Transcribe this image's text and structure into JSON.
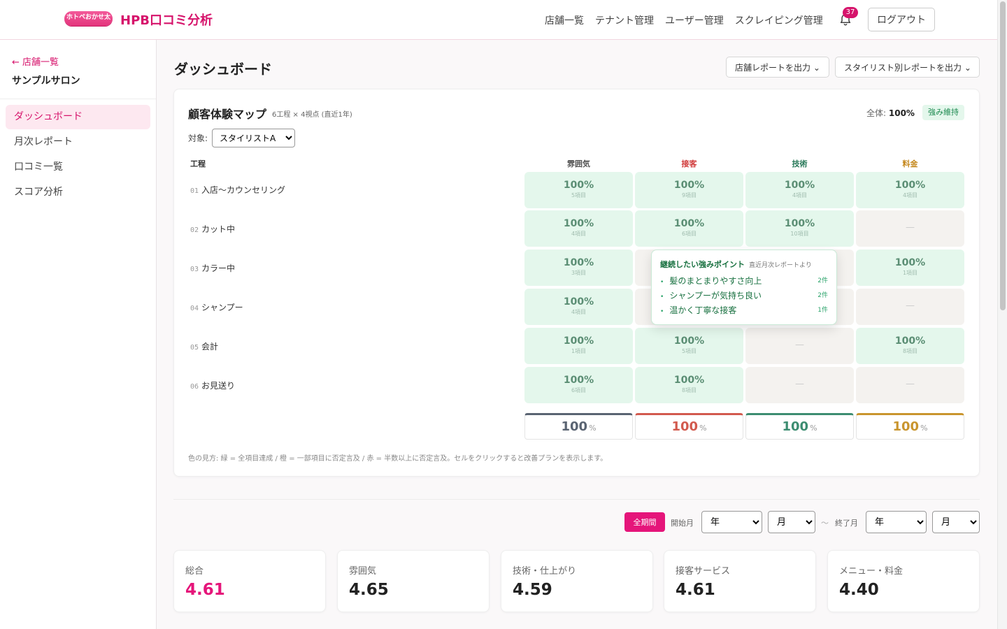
{
  "header": {
    "logo_badge": "ホトペおかせ太",
    "app_title": "HPB口コミ分析",
    "nav": [
      "店舗一覧",
      "テナント管理",
      "ユーザー管理",
      "スクレイピング管理"
    ],
    "notification_count": "37",
    "logout_label": "ログアウト"
  },
  "sidebar": {
    "back_label": "← 店舗一覧",
    "salon_name": "サンプルサロン",
    "items": [
      {
        "label": "ダッシュボード",
        "active": true
      },
      {
        "label": "月次レポート",
        "active": false
      },
      {
        "label": "口コミ一覧",
        "active": false
      },
      {
        "label": "スコア分析",
        "active": false
      }
    ]
  },
  "page": {
    "title": "ダッシュボード",
    "store_report_label": "店舗レポートを出力",
    "stylist_report_label": "スタイリスト別レポートを出力"
  },
  "map": {
    "title": "顧客体験マップ",
    "subtitle": "6工程 × 4視点 (直近1年)",
    "overall_label": "全体:",
    "overall_value": "100%",
    "status_badge": "強み維持",
    "target_label": "対象:",
    "target_value": "スタイリストA",
    "process_header": "工程",
    "columns": [
      {
        "label": "雰囲気",
        "color": "#555555",
        "accent": "#5a6472"
      },
      {
        "label": "接客",
        "color": "#d13d3d",
        "accent": "#d25a4e"
      },
      {
        "label": "技術",
        "color": "#2a7a5a",
        "accent": "#3d8d71"
      },
      {
        "label": "料金",
        "color": "#c4871b",
        "accent": "#c9952e"
      }
    ],
    "rows": [
      {
        "num": "01",
        "label": "入店〜カウンセリング",
        "cells": [
          {
            "pct": "100%",
            "count": "5項目"
          },
          {
            "pct": "100%",
            "count": "9項目"
          },
          {
            "pct": "100%",
            "count": "4項目"
          },
          {
            "pct": "100%",
            "count": "4項目"
          }
        ]
      },
      {
        "num": "02",
        "label": "カット中",
        "cells": [
          {
            "pct": "100%",
            "count": "4項目"
          },
          {
            "pct": "100%",
            "count": "6項目"
          },
          {
            "pct": "100%",
            "count": "10項目"
          },
          null
        ]
      },
      {
        "num": "03",
        "label": "カラー中",
        "cells": [
          {
            "pct": "100%",
            "count": "3項目"
          },
          null,
          null,
          {
            "pct": "100%",
            "count": "1項目"
          }
        ]
      },
      {
        "num": "04",
        "label": "シャンプー",
        "cells": [
          {
            "pct": "100%",
            "count": "4項目"
          },
          null,
          null,
          null
        ]
      },
      {
        "num": "05",
        "label": "会計",
        "cells": [
          {
            "pct": "100%",
            "count": "1項目"
          },
          {
            "pct": "100%",
            "count": "5項目"
          },
          null,
          {
            "pct": "100%",
            "count": "8項目"
          }
        ]
      },
      {
        "num": "06",
        "label": "お見送り",
        "cells": [
          {
            "pct": "100%",
            "count": "6項目"
          },
          {
            "pct": "100%",
            "count": "8項目"
          },
          null,
          null
        ]
      }
    ],
    "na_symbol": "—",
    "totals": [
      {
        "value": "100",
        "unit": "%"
      },
      {
        "value": "100",
        "unit": "%"
      },
      {
        "value": "100",
        "unit": "%"
      },
      {
        "value": "100",
        "unit": "%"
      }
    ],
    "legend_note": "色の見方: 緑 = 全項目達成 / 橙 = 一部項目に否定言及 / 赤 = 半数以上に否定言及。セルをクリックすると改善プランを表示します。"
  },
  "tooltip": {
    "title": "継続したい強みポイント",
    "note": "直近月次レポートより",
    "items": [
      {
        "text": "髪のまとまりやすさ向上",
        "count": "2件"
      },
      {
        "text": "シャンプーが気持ち良い",
        "count": "2件"
      },
      {
        "text": "温かく丁寧な接客",
        "count": "1件"
      }
    ]
  },
  "filters": {
    "all_period_label": "全期間",
    "start_label": "開始月",
    "end_label": "終了月",
    "separator": "〜",
    "year_placeholder": "年",
    "month_placeholder": "月"
  },
  "scores": [
    {
      "label": "総合",
      "value": "4.61",
      "color": "#e5157a"
    },
    {
      "label": "雰囲気",
      "value": "4.65",
      "color": "#222222"
    },
    {
      "label": "技術・仕上がり",
      "value": "4.59",
      "color": "#222222"
    },
    {
      "label": "接客サービス",
      "value": "4.61",
      "color": "#222222"
    },
    {
      "label": "メニュー・料金",
      "value": "4.40",
      "color": "#222222"
    }
  ]
}
